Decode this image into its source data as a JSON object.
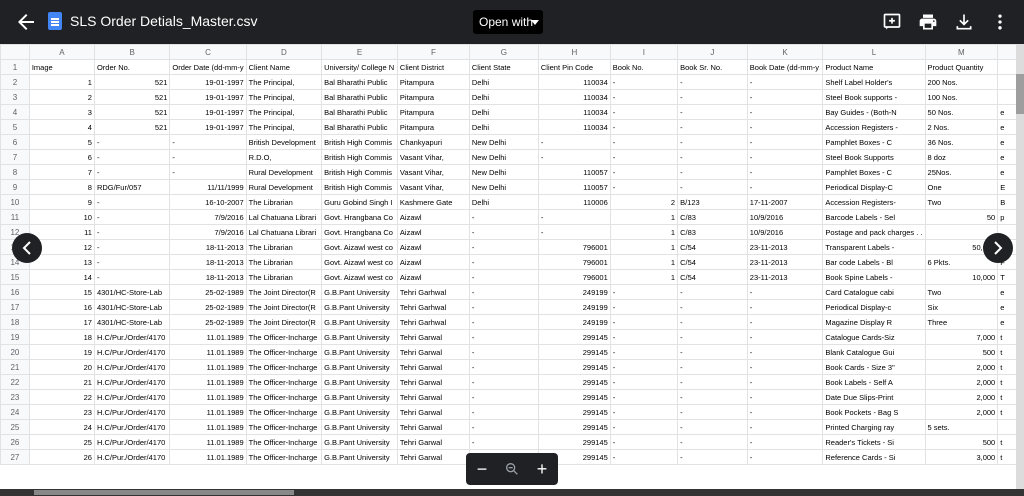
{
  "header": {
    "filename": "SLS Order Detials_Master.csv",
    "open_with": "Open with"
  },
  "icons": {
    "back": "arrow-left-icon",
    "file": "spreadsheet-file-icon",
    "add_comment": "add-comment-icon",
    "print": "print-icon",
    "download": "download-icon",
    "more": "more-vert-icon",
    "prev": "chevron-left-icon",
    "next": "chevron-right-icon"
  },
  "columns": [
    "A",
    "B",
    "C",
    "D",
    "E",
    "F",
    "G",
    "H",
    "I",
    "J",
    "K",
    "L",
    "M",
    ""
  ],
  "rows": [
    [
      "Image",
      "Order No.",
      "Order Date (dd-mm-y",
      "Client Name",
      "University/ College N",
      "Client District",
      "Client State",
      "Client Pin Code",
      "Book No.",
      "Book Sr. No.",
      "Book Date (dd-mm-y",
      "Product Name",
      "Product Quantity",
      ""
    ],
    [
      "1",
      "521",
      "19-01-1997",
      "The Principal,",
      "Bal Bharathi Public",
      "Pitampura",
      "Delhi",
      "110034",
      "-",
      "-",
      "-",
      "Shelf Label Holder's",
      "200 Nos.",
      ""
    ],
    [
      "2",
      "521",
      "19-01-1997",
      "The Principal,",
      "Bal Bharathi Public",
      "Pitampura",
      "Delhi",
      "110034",
      "-",
      "-",
      "-",
      "Steel Book supports -",
      "100 Nos.",
      ""
    ],
    [
      "3",
      "521",
      "19-01-1997",
      "The Principal,",
      "Bal Bharathi Public",
      "Pitampura",
      "Delhi",
      "110034",
      "-",
      "-",
      "-",
      "Bay Guides - (Both-N",
      "50 Nos.",
      "e"
    ],
    [
      "4",
      "521",
      "19-01-1997",
      "The Principal,",
      "Bal Bharathi Public",
      "Pitampura",
      "Delhi",
      "110034",
      "-",
      "-",
      "-",
      "Accession Registers -",
      "2 Nos.",
      "e"
    ],
    [
      "5",
      "-",
      "-",
      "British Development",
      "British High Commis",
      "Chankyapuri",
      "New Delhi",
      "-",
      "-",
      "-",
      "-",
      "Pamphlet Boxes - C",
      "36 Nos.",
      "e"
    ],
    [
      "6",
      "-",
      "-",
      "R.D.O,",
      "British High Commis",
      "Vasant Vihar,",
      "New Delhi",
      "-",
      "-",
      "-",
      "-",
      "Steel Book Supports",
      "8 doz",
      "e"
    ],
    [
      "7",
      "-",
      "-",
      "Rural Development",
      "British High Commis",
      "Vasant Vihar,",
      "New Delhi",
      "110057",
      "-",
      "-",
      "-",
      "Pamphlet Boxes - C",
      "25Nos.",
      "e"
    ],
    [
      "8",
      "RDG/Fur/057",
      "11/11/1999",
      "Rural Development",
      "British High Commis",
      "Vasant Vihar,",
      "New Delhi",
      "110057",
      "-",
      "-",
      "-",
      "Periodical Display-C",
      "One",
      "E"
    ],
    [
      "9",
      "-",
      "16-10-2007",
      "The Librarian",
      "Guru Gobind Singh I",
      "Kashmere Gate",
      "Delhi",
      "110006",
      "2",
      "B/123",
      "17-11-2007",
      "Accession Registers-",
      "Two",
      "B"
    ],
    [
      "10",
      "-",
      "7/9/2016",
      "Lal Chatuana Librari",
      "Govt. Hrangbana Co",
      "Aizawl",
      "-",
      "-",
      "1",
      "C/83",
      "10/9/2016",
      "Barcode Labels - Sel",
      "50",
      "p"
    ],
    [
      "11",
      "-",
      "7/9/2016",
      "Lal Chatuana Librari",
      "Govt. Hrangbana Co",
      "Aizawl",
      "-",
      "-",
      "1",
      "C/83",
      "10/9/2016",
      "Postage and pack charges . .",
      "",
      ""
    ],
    [
      "12",
      "-",
      "18-11-2013",
      "The Librarian",
      "Govt. Aizawl west co",
      "Aizawl",
      "-",
      "796001",
      "1",
      "C/54",
      "23-11-2013",
      "Transparent Labels -",
      "50,000",
      "T"
    ],
    [
      "13",
      "-",
      "18-11-2013",
      "The Librarian",
      "Govt. Aizawl west co",
      "Aizawl",
      "-",
      "796001",
      "1",
      "C/54",
      "23-11-2013",
      "Bar code Labels - Bl",
      "6 Pkts.",
      "F"
    ],
    [
      "14",
      "-",
      "18-11-2013",
      "The Librarian",
      "Govt. Aizawl west co",
      "Aizawl",
      "-",
      "796001",
      "1",
      "C/54",
      "23-11-2013",
      "Book Spine Labels -",
      "10,000",
      "T"
    ],
    [
      "15",
      "4301/HC-Store-Lab",
      "25-02-1989",
      "The Joint Director(R",
      "G.B.Pant University",
      "Tehri Garhwal",
      "-",
      "249199",
      "-",
      "-",
      "-",
      "Card Catalogue cabi",
      "Two",
      "e"
    ],
    [
      "16",
      "4301/HC-Store-Lab",
      "25-02-1989",
      "The Joint Director(R",
      "G.B.Pant University",
      "Tehri Garhwal",
      "-",
      "249199",
      "-",
      "-",
      "-",
      "Periodical Display-c",
      "Six",
      "e"
    ],
    [
      "17",
      "4301/HC-Store-Lab",
      "25-02-1989",
      "The Joint Director(R",
      "G.B.Pant University",
      "Tehri Garhwal",
      "-",
      "249199",
      "-",
      "-",
      "-",
      "Magazine Display R",
      "Three",
      "e"
    ],
    [
      "18",
      "H.C/Pur./Order/4170",
      "11.01.1989",
      "The Officer-Incharge",
      "G.B.Pant University",
      "Tehri Garwal",
      "-",
      "299145",
      "-",
      "-",
      "-",
      "Catalogue Cards-Siz",
      "7,000",
      "t"
    ],
    [
      "19",
      "H.C/Pur./Order/4170",
      "11.01.1989",
      "The Officer-Incharge",
      "G.B.Pant University",
      "Tehri Garwal",
      "-",
      "299145",
      "-",
      "-",
      "-",
      "Blank Catalogue Gui",
      "500",
      "t"
    ],
    [
      "20",
      "H.C/Pur./Order/4170",
      "11.01.1989",
      "The Officer-Incharge",
      "G.B.Pant University",
      "Tehri Garwal",
      "-",
      "299145",
      "-",
      "-",
      "-",
      "Book Cards - Size 3\"",
      "2,000",
      "t"
    ],
    [
      "21",
      "H.C/Pur./Order/4170",
      "11.01.1989",
      "The Officer-Incharge",
      "G.B.Pant University",
      "Tehri Garwal",
      "-",
      "299145",
      "-",
      "-",
      "-",
      "Book Labels - Self A",
      "2,000",
      "t"
    ],
    [
      "22",
      "H.C/Pur./Order/4170",
      "11.01.1989",
      "The Officer-Incharge",
      "G.B.Pant University",
      "Tehri Garwal",
      "-",
      "299145",
      "-",
      "-",
      "-",
      "Date Due Slips-Print",
      "2,000",
      "t"
    ],
    [
      "23",
      "H.C/Pur./Order/4170",
      "11.01.1989",
      "The Officer-Incharge",
      "G.B.Pant University",
      "Tehri Garwal",
      "-",
      "299145",
      "-",
      "-",
      "-",
      "Book Pockets - Bag S",
      "2,000",
      "t"
    ],
    [
      "24",
      "H.C/Pur./Order/4170",
      "11.01.1989",
      "The Officer-Incharge",
      "G.B.Pant University",
      "Tehri Garwal",
      "-",
      "299145",
      "-",
      "-",
      "-",
      "Printed Charging ray",
      "5 sets.",
      ""
    ],
    [
      "25",
      "H.C/Pur./Order/4170",
      "11.01.1989",
      "The Officer-Incharge",
      "G.B.Pant University",
      "Tehri Garwal",
      "-",
      "299145",
      "-",
      "-",
      "-",
      "Reader's Tickets - Si",
      "500",
      "t"
    ],
    [
      "26",
      "H.C/Pur./Order/4170",
      "11.01.1989",
      "The Officer-Incharge",
      "G.B.Pant University",
      "Tehri Garwal",
      "-",
      "299145",
      "-",
      "-",
      "-",
      "Reference Cards - Si",
      "3,000",
      "t"
    ]
  ],
  "zoom": {
    "out": "−",
    "in": "+"
  }
}
